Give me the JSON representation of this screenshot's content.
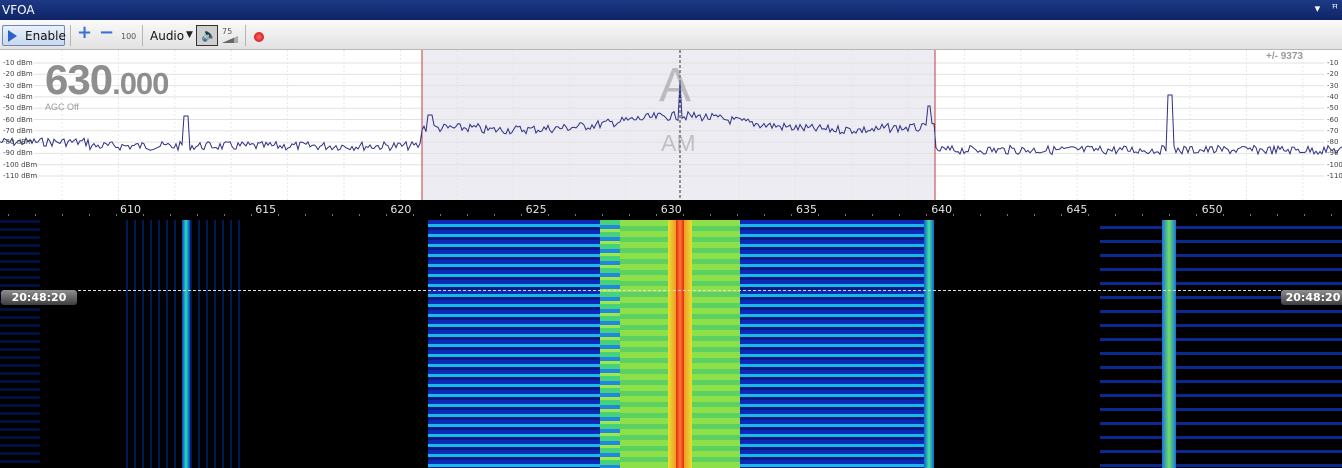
{
  "window": {
    "title": "VFOA",
    "menu_icon": "caret-down-icon",
    "pin_icon": "pin-icon"
  },
  "toolbar": {
    "enable_label": "Enable",
    "zoom_step": "100",
    "audio_label": "Audio",
    "volume": "75",
    "record_color": "#d40000"
  },
  "readout": {
    "freq_main": "630",
    "freq_small": ".000",
    "agc": "AGC Off",
    "span": "+/- 9373",
    "vfo_letter": "A",
    "mode": "AM"
  },
  "db_labels": [
    "-10 dBm",
    "-20 dBm",
    "-30 dBm",
    "-40 dBm",
    "-50 dBm",
    "-60 dBm",
    "-70 dBm",
    "-80 dBm",
    "-90 dBm",
    "-100 dBm",
    "-110 dBm"
  ],
  "db_labels_right": [
    "-10",
    "-20",
    "-30",
    "-40",
    "-50",
    "-60",
    "-70",
    "-80",
    "-90",
    "-100",
    "-110"
  ],
  "freq_ticks": [
    "610",
    "615",
    "620",
    "625",
    "630",
    "635",
    "640",
    "645",
    "650"
  ],
  "waterfall": {
    "time_left": "20:48:20",
    "time_right": "20:48:20"
  },
  "colors": {
    "spectrum_line": "#2e2e86",
    "passband_edge": "#c23a3a",
    "titlebar": "#1b357f"
  }
}
